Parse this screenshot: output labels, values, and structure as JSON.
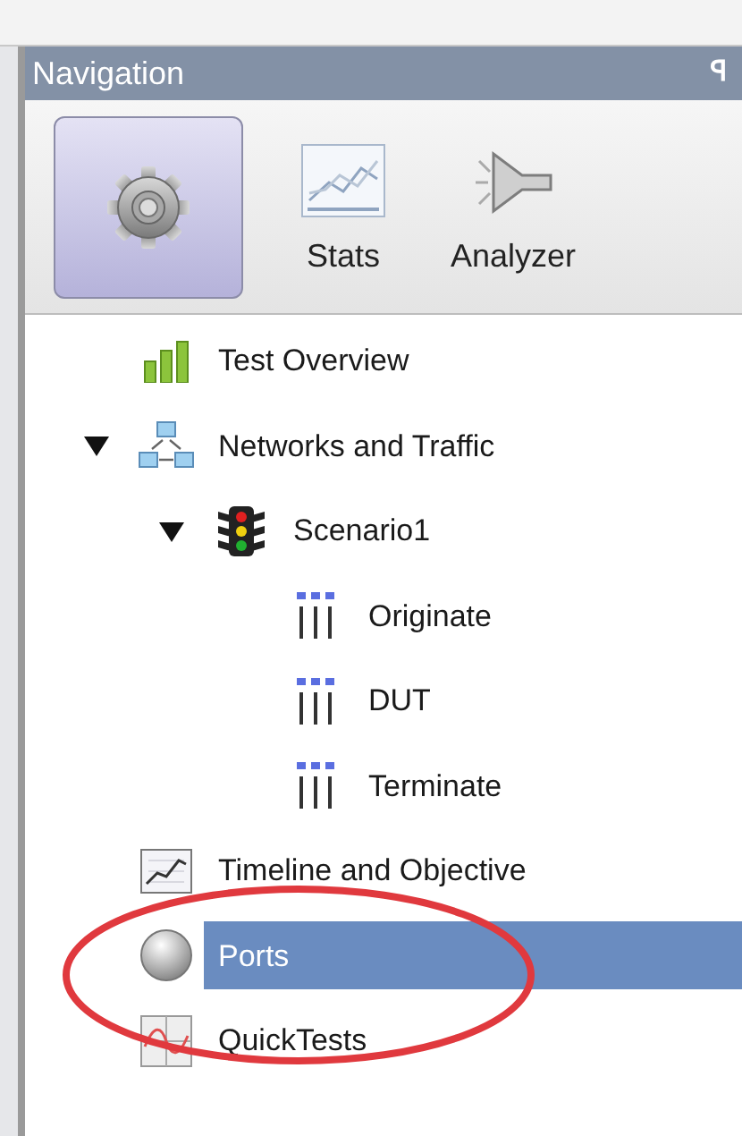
{
  "panel": {
    "title": "Navigation",
    "pin": "ꟼ"
  },
  "toolbar": [
    {
      "kind": "gear",
      "selected": true
    },
    {
      "kind": "stats",
      "label": "Stats",
      "selected": false
    },
    {
      "kind": "funnel",
      "label": "Analyzer",
      "selected": false
    }
  ],
  "tree": [
    {
      "label": "Test Overview",
      "kind": "bars",
      "selected": false
    },
    {
      "label": "Networks and Traffic",
      "kind": "network",
      "selected": false,
      "expanded": true,
      "children": [
        {
          "label": "Scenario1",
          "kind": "traffic-light",
          "selected": false,
          "expanded": true,
          "children": [
            {
              "label": "Originate",
              "kind": "columns",
              "selected": false
            },
            {
              "label": "DUT",
              "kind": "columns",
              "selected": false
            },
            {
              "label": "Terminate",
              "kind": "columns",
              "selected": false
            }
          ]
        }
      ]
    },
    {
      "label": "Timeline and Objective",
      "kind": "timeline",
      "selected": false
    },
    {
      "label": "Ports",
      "kind": "sphere",
      "selected": true
    },
    {
      "label": "QuickTests",
      "kind": "quicktests",
      "selected": false
    }
  ],
  "annotation": {
    "kind": "ellipse",
    "color": "#e0393e"
  }
}
